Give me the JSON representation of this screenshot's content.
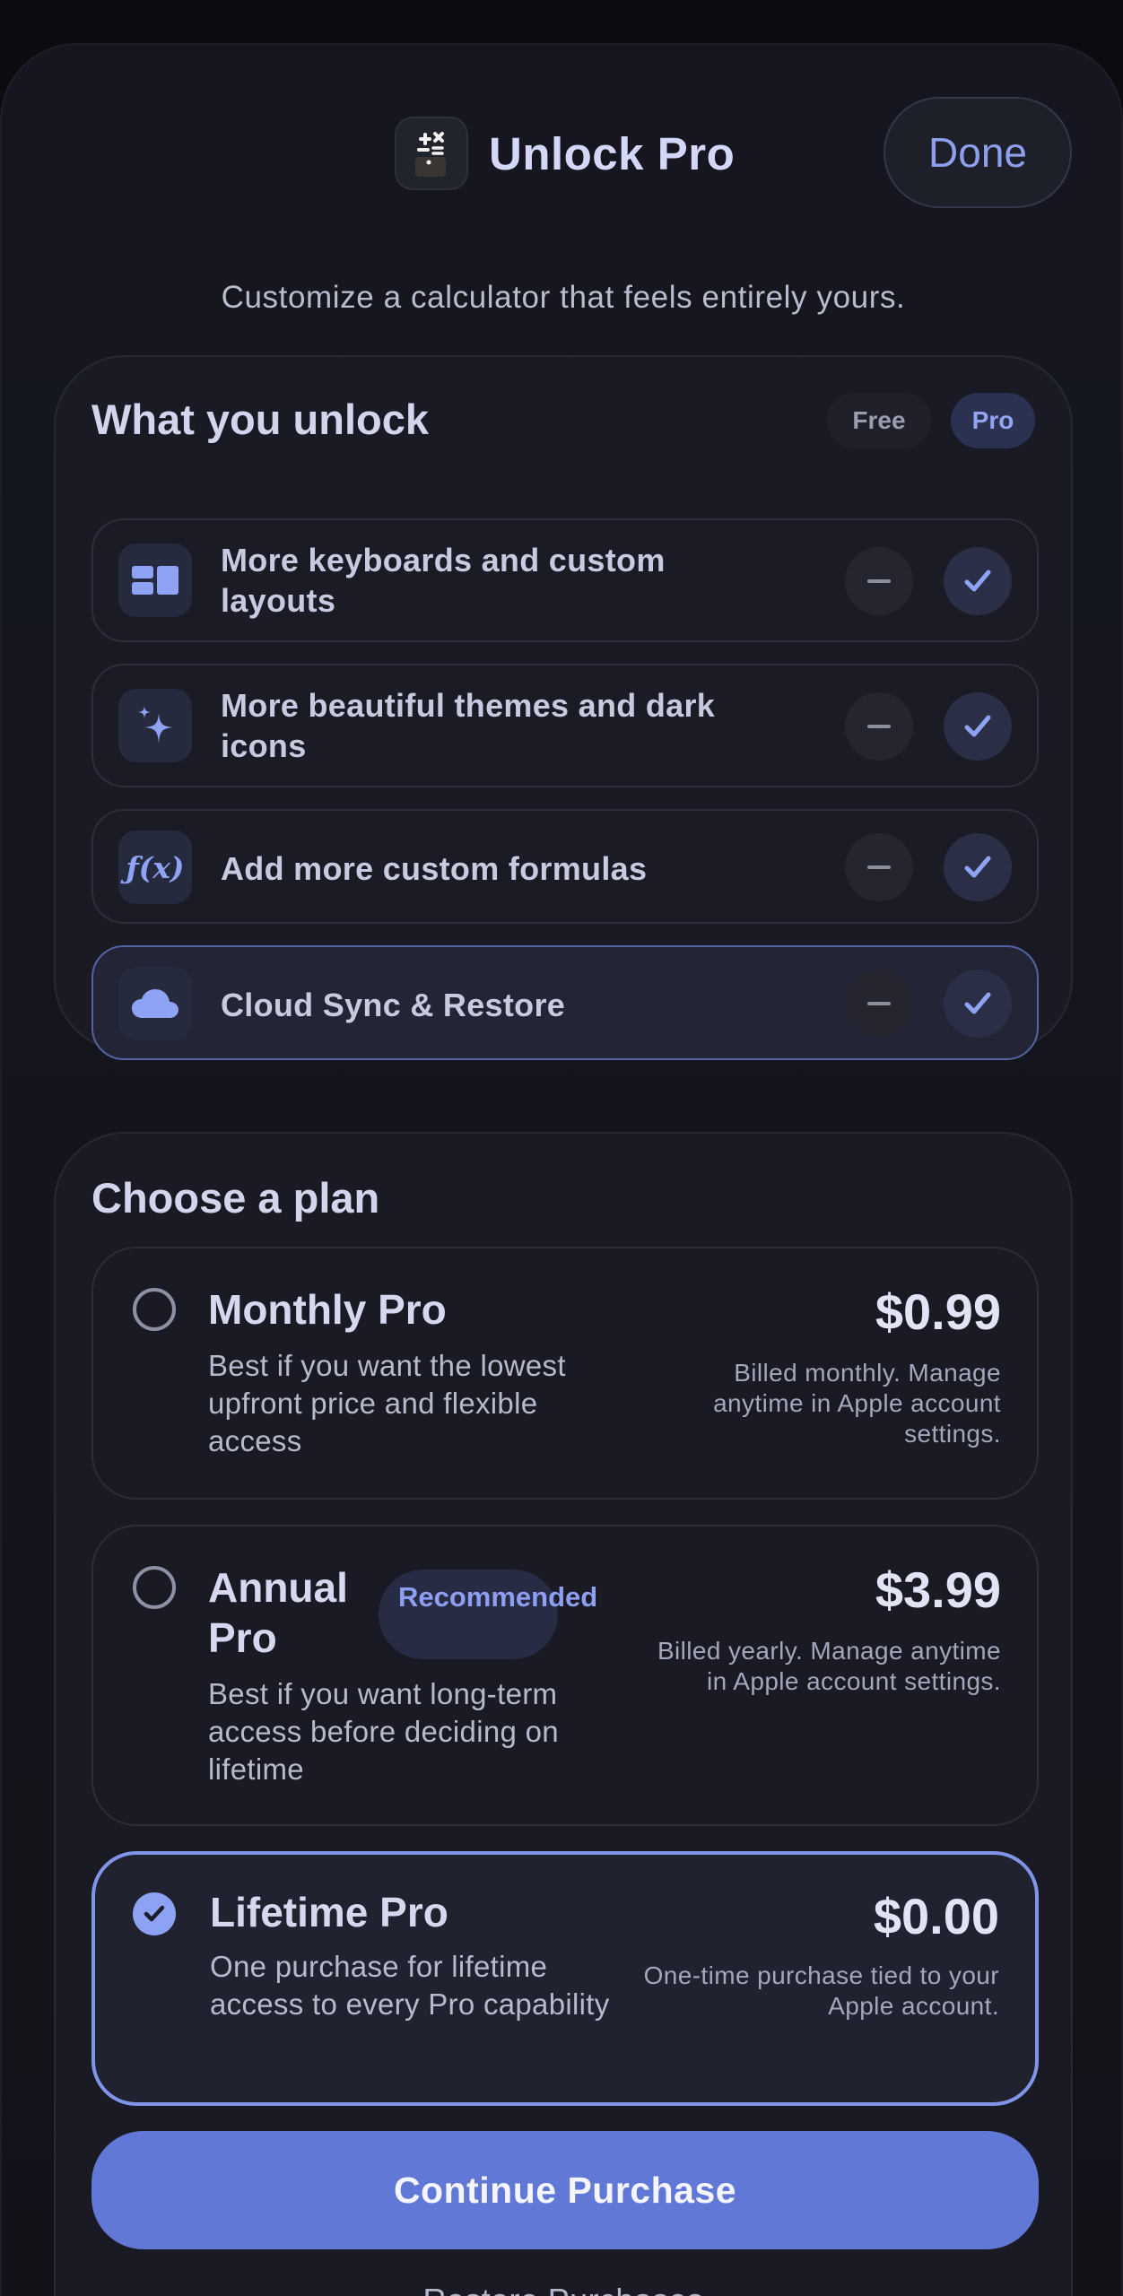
{
  "header": {
    "title": "Unlock Pro",
    "done_label": "Done",
    "subtitle": "Customize a calculator that feels entirely yours."
  },
  "unlock": {
    "title": "What you unlock",
    "free_label": "Free",
    "pro_label": "Pro",
    "features": [
      {
        "label": "More keyboards and custom layouts",
        "icon": "keyboard-layout-icon"
      },
      {
        "label": "More beautiful themes and dark icons",
        "icon": "sparkle-icon"
      },
      {
        "label": "Add more custom formulas",
        "icon": "function-icon",
        "icon_text": "ƒ(x)"
      },
      {
        "label": "Cloud Sync & Restore",
        "icon": "cloud-icon"
      }
    ]
  },
  "plans": {
    "title": "Choose a plan",
    "items": [
      {
        "name": "Monthly Pro",
        "description": "Best if you want the lowest upfront price and flexible access",
        "price": "$0.99",
        "note": "Billed monthly. Manage anytime in Apple account settings.",
        "selected": false
      },
      {
        "name": "Annual Pro",
        "badge": "Recommended",
        "description": "Best if you want long-term access before deciding on lifetime",
        "price": "$3.99",
        "note": "Billed yearly. Manage anytime in Apple account settings.",
        "selected": false
      },
      {
        "name": "Lifetime Pro",
        "description": "One purchase for lifetime access to every Pro capability",
        "price": "$0.00",
        "note": "One-time purchase tied to your Apple account.",
        "selected": true
      }
    ],
    "continue_label": "Continue Purchase",
    "restore_label": "Restore Purchases"
  },
  "colors": {
    "accent": "#6278d6",
    "accent_light": "#8da2f3",
    "background": "#14151d"
  }
}
